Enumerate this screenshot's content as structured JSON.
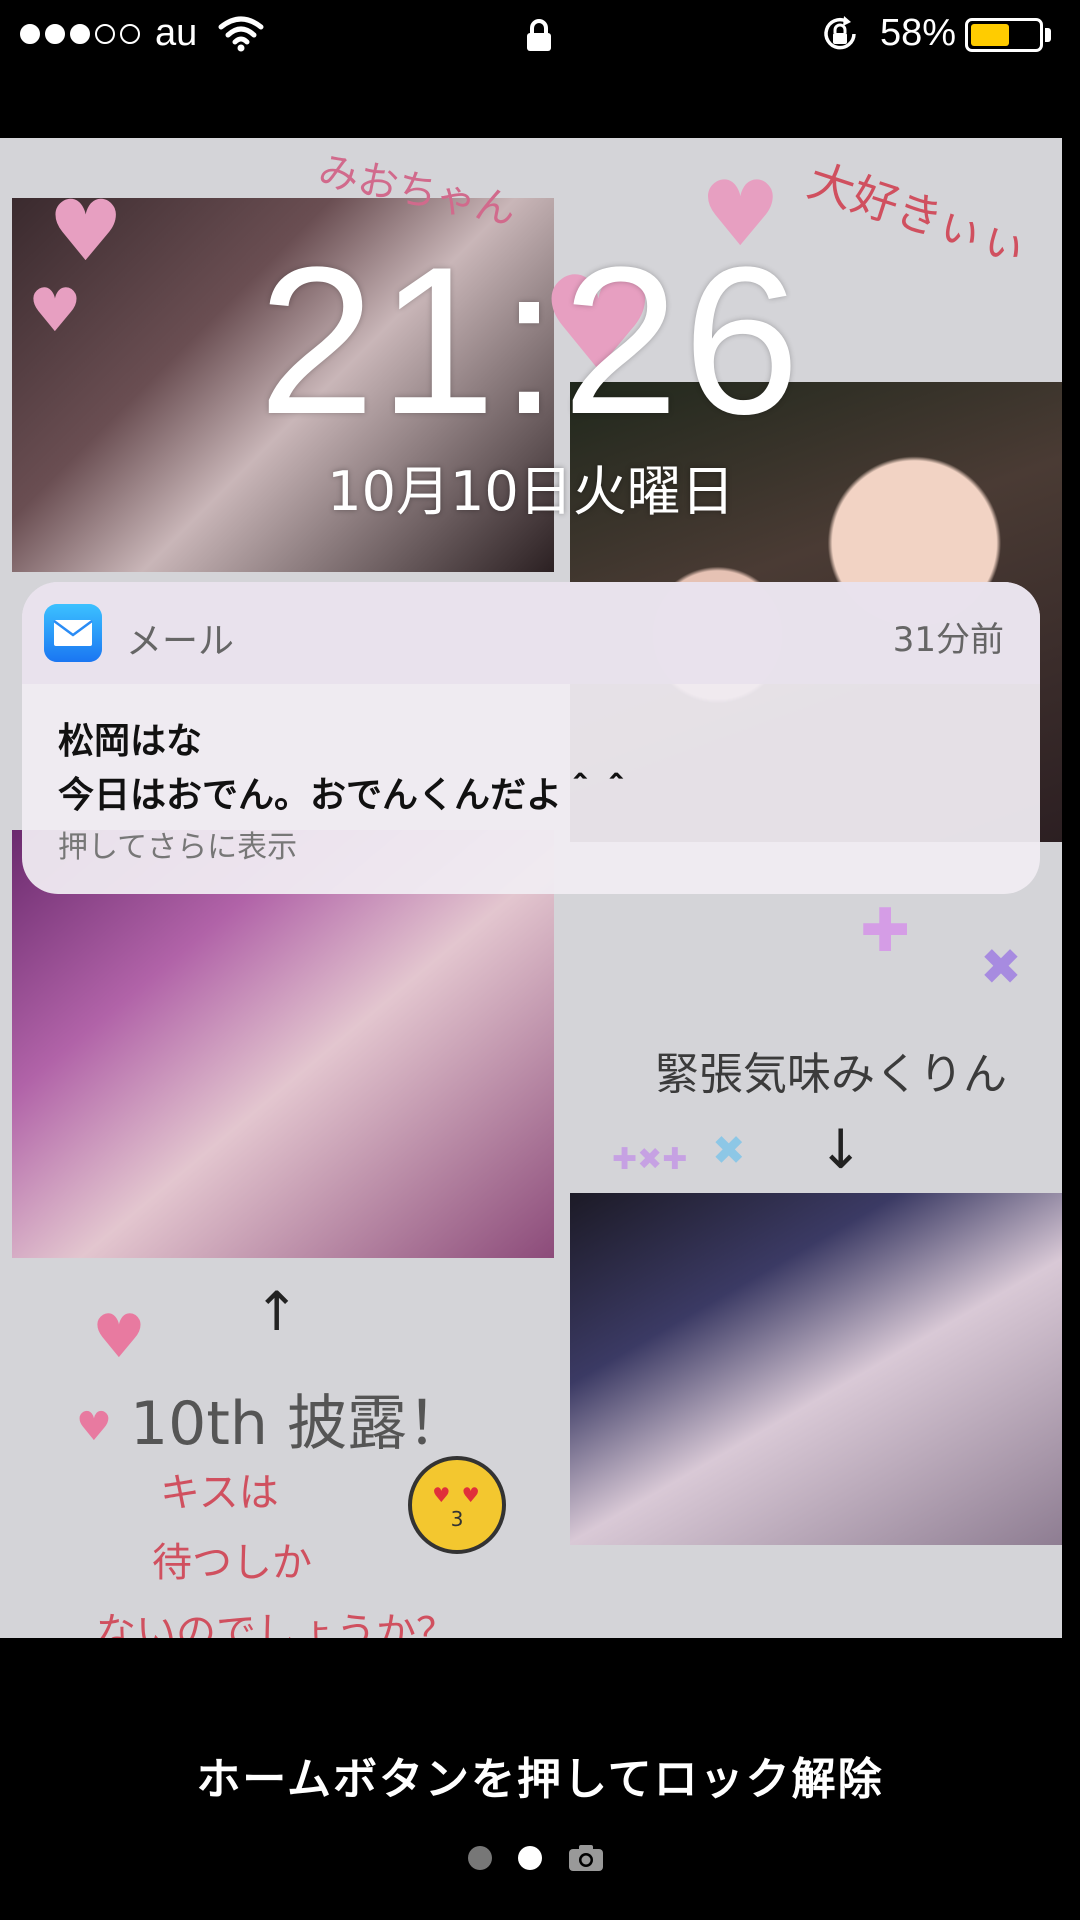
{
  "status_bar": {
    "signal_strength": 3,
    "signal_max": 5,
    "carrier": "au",
    "wifi_icon": "wifi-icon",
    "lock_icon": "lock-icon",
    "orientation_icon": "orientation-lock-icon",
    "battery_percent": "58%",
    "battery_level": 0.58,
    "battery_color": "#ffcc00"
  },
  "lock_screen": {
    "time": "21:26",
    "date": "10月10日火曜日"
  },
  "wallpaper": {
    "text_mio": "みおちゃん",
    "text_daisuki": "大好きぃぃ",
    "text_kincho": "緊張気味みくりん",
    "arrow_down": "↓",
    "arrow_up": "↑",
    "text_10th": "10th 披露！",
    "text_kiss_1": "キスは",
    "text_kiss_2": "待つしか",
    "text_kiss_3": "ないのでしょうか？"
  },
  "notification": {
    "app_icon": "mail-icon",
    "app_name": "メール",
    "time_ago": "31分前",
    "sender": "松岡はな",
    "message": "今日はおでん。おでんくんだよ＾＾",
    "hint": "押してさらに表示"
  },
  "bottom": {
    "unlock_hint": "ホームボタンを押してロック解除",
    "page_count": 2,
    "active_page": 2,
    "camera_icon": "camera-icon"
  }
}
